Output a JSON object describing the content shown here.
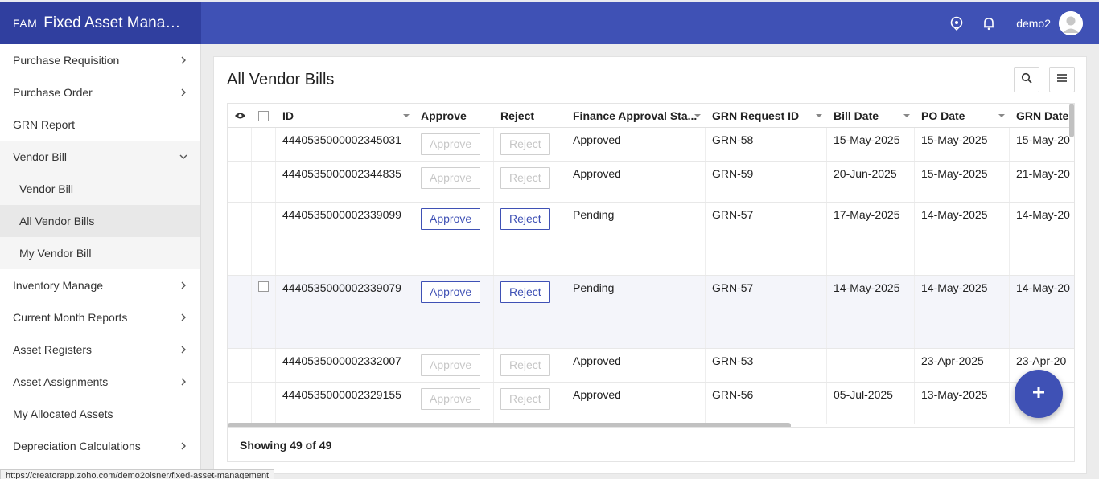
{
  "app": {
    "short": "FAM",
    "title": "Fixed Asset Manage..."
  },
  "header": {
    "user": "demo2"
  },
  "sidebar": {
    "items": [
      {
        "label": "Purchase Requisition",
        "chevron": "right"
      },
      {
        "label": "Purchase Order",
        "chevron": "right"
      },
      {
        "label": "GRN Report",
        "chevron": ""
      },
      {
        "label": "Vendor Bill",
        "chevron": "down"
      },
      {
        "label": "Inventory Manage",
        "chevron": "right"
      },
      {
        "label": "Current Month Reports",
        "chevron": "right"
      },
      {
        "label": "Asset Registers",
        "chevron": "right"
      },
      {
        "label": "Asset Assignments",
        "chevron": "right"
      },
      {
        "label": "My Allocated Assets",
        "chevron": ""
      },
      {
        "label": "Depreciation Calculations",
        "chevron": "right"
      }
    ],
    "subitems": [
      "Vendor Bill",
      "All Vendor Bills",
      "My Vendor Bill"
    ]
  },
  "main": {
    "title": "All Vendor Bills",
    "columns": [
      "ID",
      "Approve",
      "Reject",
      "Finance Approval Sta...",
      "GRN Request ID",
      "Bill Date",
      "PO Date",
      "GRN Date"
    ],
    "rows": [
      {
        "id": "4440535000002345031",
        "approve": "Approve",
        "reject": "Reject",
        "status": "Approved",
        "grn": "GRN-58",
        "bill_date": "15-May-2025",
        "po_date": "15-May-2025",
        "grn_date": "15-May-20"
      },
      {
        "id": "4440535000002344835",
        "approve": "Approve",
        "reject": "Reject",
        "status": "Approved",
        "grn": "GRN-59",
        "bill_date": "20-Jun-2025",
        "po_date": "15-May-2025",
        "grn_date": "21-May-20"
      },
      {
        "id": "4440535000002339099",
        "approve": "Approve",
        "reject": "Reject",
        "status": "Pending",
        "grn": "GRN-57",
        "bill_date": "17-May-2025",
        "po_date": "14-May-2025",
        "grn_date": "14-May-20"
      },
      {
        "id": "4440535000002339079",
        "approve": "Approve",
        "reject": "Reject",
        "status": "Pending",
        "grn": "GRN-57",
        "bill_date": "14-May-2025",
        "po_date": "14-May-2025",
        "grn_date": "14-May-20"
      },
      {
        "id": "4440535000002332007",
        "approve": "Approve",
        "reject": "Reject",
        "status": "Approved",
        "grn": "GRN-53",
        "bill_date": "",
        "po_date": "23-Apr-2025",
        "grn_date": "23-Apr-20"
      },
      {
        "id": "4440535000002329155",
        "approve": "Approve",
        "reject": "Reject",
        "status": "Approved",
        "grn": "GRN-56",
        "bill_date": "05-Jul-2025",
        "po_date": "13-May-2025",
        "grn_date": ""
      }
    ],
    "footer": "Showing 49 of 49"
  },
  "statusbar": {
    "url": "https://creatorapp.zoho.com/demo2olsner/fixed-asset-management"
  },
  "colors": {
    "primary": "#3f51b5",
    "brand_dark": "#303f9f"
  }
}
